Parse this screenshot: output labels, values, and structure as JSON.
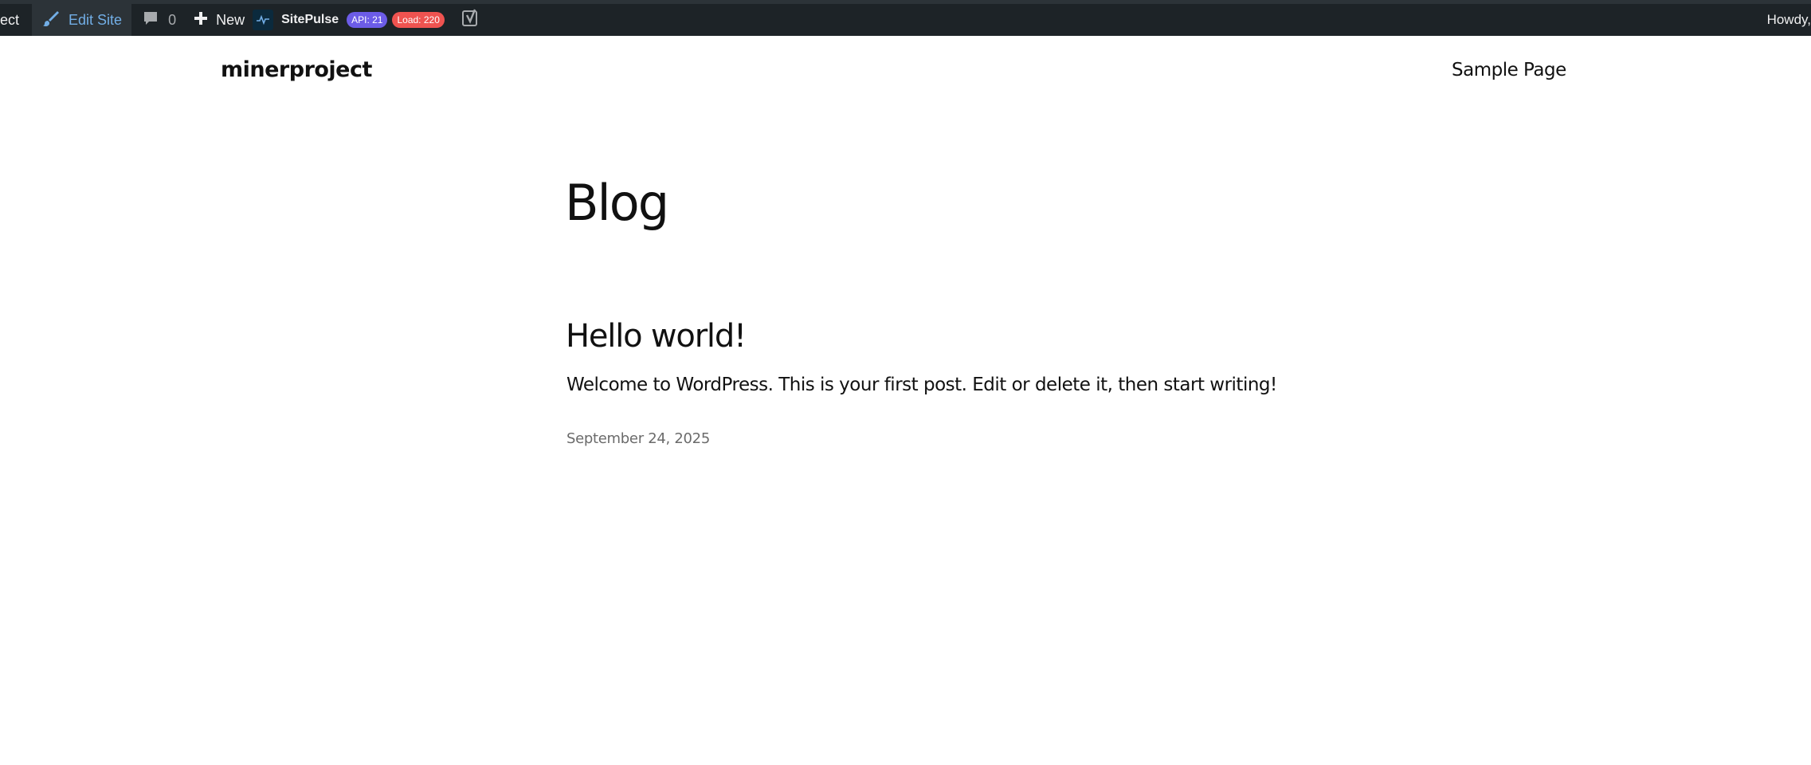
{
  "adminbar": {
    "site_name": "ect",
    "edit_site_label": "Edit Site",
    "comments_count": "0",
    "new_label": "New",
    "sitepulse_label": "SitePulse",
    "api_badge": "API: 21",
    "load_badge": "Load: 220",
    "howdy": "Howdy,",
    "icons": [
      "pencil-brush-icon",
      "comment-bubble-icon",
      "plus-icon",
      "pulse-icon",
      "yoast-icon"
    ],
    "colors": {
      "bar_bg": "#1d2327",
      "edit_text": "#72aee6",
      "api_badge": "#6c5ce7",
      "load_badge": "#ef5350"
    }
  },
  "header": {
    "site_title": "minerproject",
    "nav": [
      "Sample Page"
    ]
  },
  "main": {
    "page_title": "Blog",
    "posts": [
      {
        "title": "Hello world!",
        "excerpt": "Welcome to WordPress. This is your first post. Edit or delete it, then start writing!",
        "date": "September 24, 2025"
      }
    ]
  }
}
